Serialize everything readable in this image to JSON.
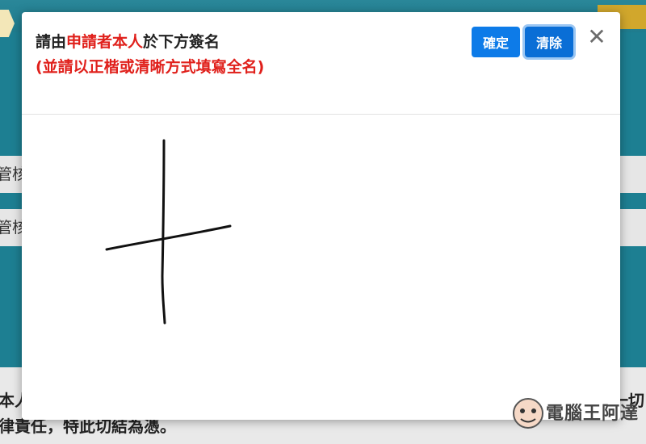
{
  "background": {
    "bar1_text": "管核",
    "bar2_text": "管核",
    "bottom_line1_left": "本人",
    "bottom_line1_right": "一切",
    "bottom_line2": "律責任，特此切結為憑。"
  },
  "dialog": {
    "title_prefix": "請由",
    "title_highlight": "申請者本人",
    "title_suffix": "於下方簽名",
    "subtitle": "(並請以正楷或清晰方式填寫全名)",
    "confirm_label": "確定",
    "clear_label": "清除",
    "close_glyph": "✕"
  },
  "watermark": {
    "text": "電腦王阿達"
  }
}
